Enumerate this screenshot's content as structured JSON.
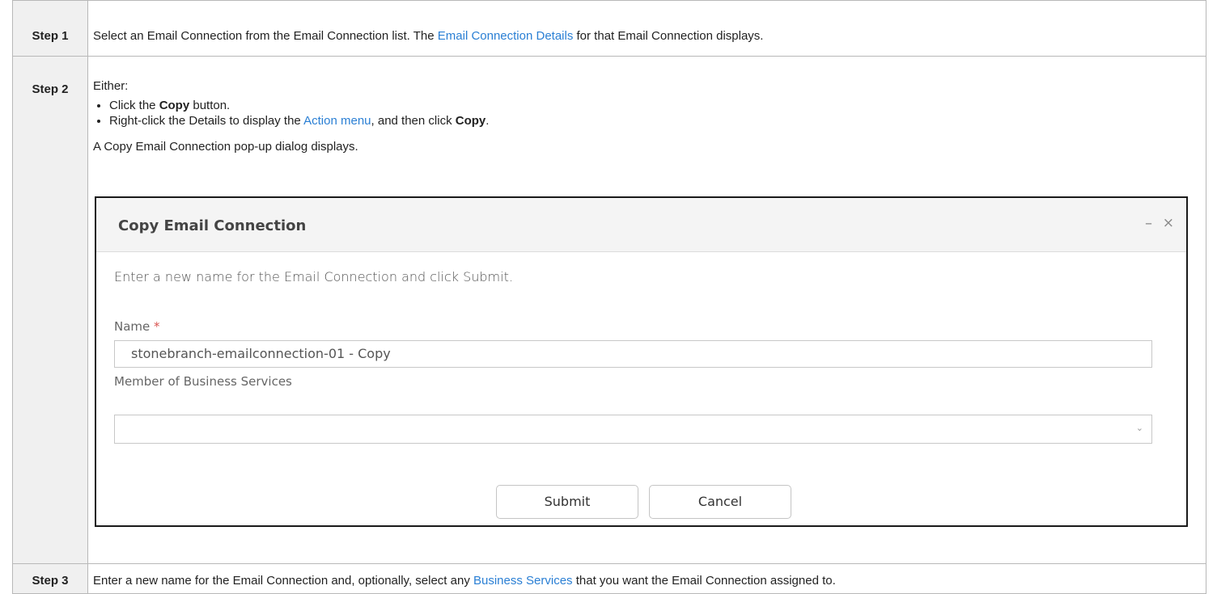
{
  "steps": [
    {
      "label": "Step 1",
      "text_before": "Select an Email Connection from the Email Connection list. The ",
      "link": "Email Connection Details",
      "text_after": " for that Email Connection displays."
    },
    {
      "label": "Step 2",
      "intro": "Either:",
      "bullet1": {
        "pre": "Click the ",
        "bold": "Copy",
        "post": " button."
      },
      "bullet2": {
        "pre": "Right-click the Details to display the ",
        "link": "Action menu",
        "mid": ", and then click ",
        "bold": "Copy",
        "post": "."
      },
      "popup_text": "A Copy Email Connection pop-up dialog displays."
    },
    {
      "label": "Step 3",
      "text_before": "Enter a new name for the Email Connection and, optionally, select any ",
      "link": "Business Services",
      "text_after": " that you want the Email Connection assigned to."
    }
  ],
  "dialog": {
    "title": "Copy Email Connection",
    "minimize_glyph": "–",
    "close_glyph": "×",
    "instruction": "Enter a new name for the Email Connection and click Submit.",
    "name_label": "Name",
    "required_mark": "*",
    "name_value": "stonebranch-emailconnection-01 - Copy",
    "member_label": "Member of Business Services",
    "member_value": "",
    "submit": "Submit",
    "cancel": "Cancel"
  },
  "colors": {
    "link": "#2a7fd4",
    "required": "#d9534f",
    "step_label_bg": "#f0f0f0"
  },
  "icons": [
    "minimize-icon",
    "close-icon",
    "chevron-down-icon"
  ]
}
